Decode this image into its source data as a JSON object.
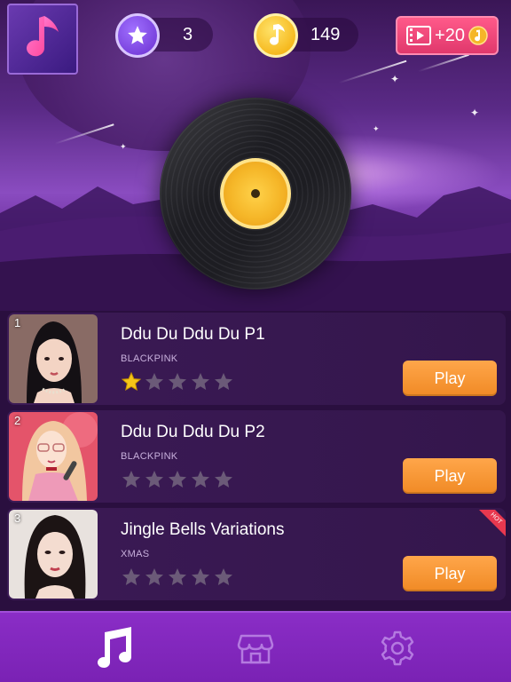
{
  "header": {
    "stars_count": "3",
    "coins_count": "149",
    "reward_label": "+20"
  },
  "songs": [
    {
      "rank": "1",
      "title": "Ddu Du Ddu Du P1",
      "artist": "BLACKPINK",
      "stars_earned": 1,
      "stars_total": 5,
      "play_label": "Play",
      "hot": false
    },
    {
      "rank": "2",
      "title": "Ddu Du Ddu Du P2",
      "artist": "BLACKPINK",
      "stars_earned": 0,
      "stars_total": 5,
      "play_label": "Play",
      "hot": false
    },
    {
      "rank": "3",
      "title": "Jingle Bells Variations",
      "artist": "XMAS",
      "stars_earned": 0,
      "stars_total": 5,
      "play_label": "Play",
      "hot": true,
      "hot_label": "HOT"
    }
  ],
  "nav": {
    "items": [
      {
        "icon": "music-note-icon",
        "active": true
      },
      {
        "icon": "shop-icon",
        "active": false
      },
      {
        "icon": "gear-icon",
        "active": false
      }
    ]
  },
  "colors": {
    "accent_purple": "#7a22b4",
    "play_orange": "#f08a25",
    "reward_pink": "#e0386c",
    "star_gold": "#f5c518",
    "star_empty": "#6b5a78"
  }
}
